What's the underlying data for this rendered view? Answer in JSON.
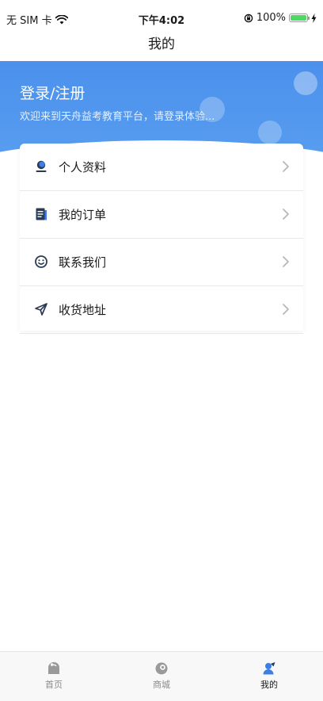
{
  "status_bar": {
    "carrier": "无 SIM 卡",
    "time": "下午4:02",
    "battery": "100%",
    "battery_level": 1.0
  },
  "nav": {
    "title": "我的"
  },
  "hero": {
    "login_label": "登录/注册",
    "welcome_text": "欢迎来到天舟益考教育平台，请登录体验..."
  },
  "menu": {
    "items": [
      {
        "label": "个人资料",
        "icon": "person-icon"
      },
      {
        "label": "我的订单",
        "icon": "order-icon"
      },
      {
        "label": "联系我们",
        "icon": "smile-icon"
      },
      {
        "label": "收货地址",
        "icon": "location-arrow-icon"
      }
    ]
  },
  "tabs": [
    {
      "label": "首页",
      "icon": "home-icon"
    },
    {
      "label": "商城",
      "icon": "shop-icon"
    },
    {
      "label": "我的",
      "icon": "profile-icon",
      "active": true
    }
  ],
  "colors": {
    "accent": "#4b90ec",
    "icon_dark": "#2b3a55",
    "icon_blue": "#3a7ee6"
  }
}
